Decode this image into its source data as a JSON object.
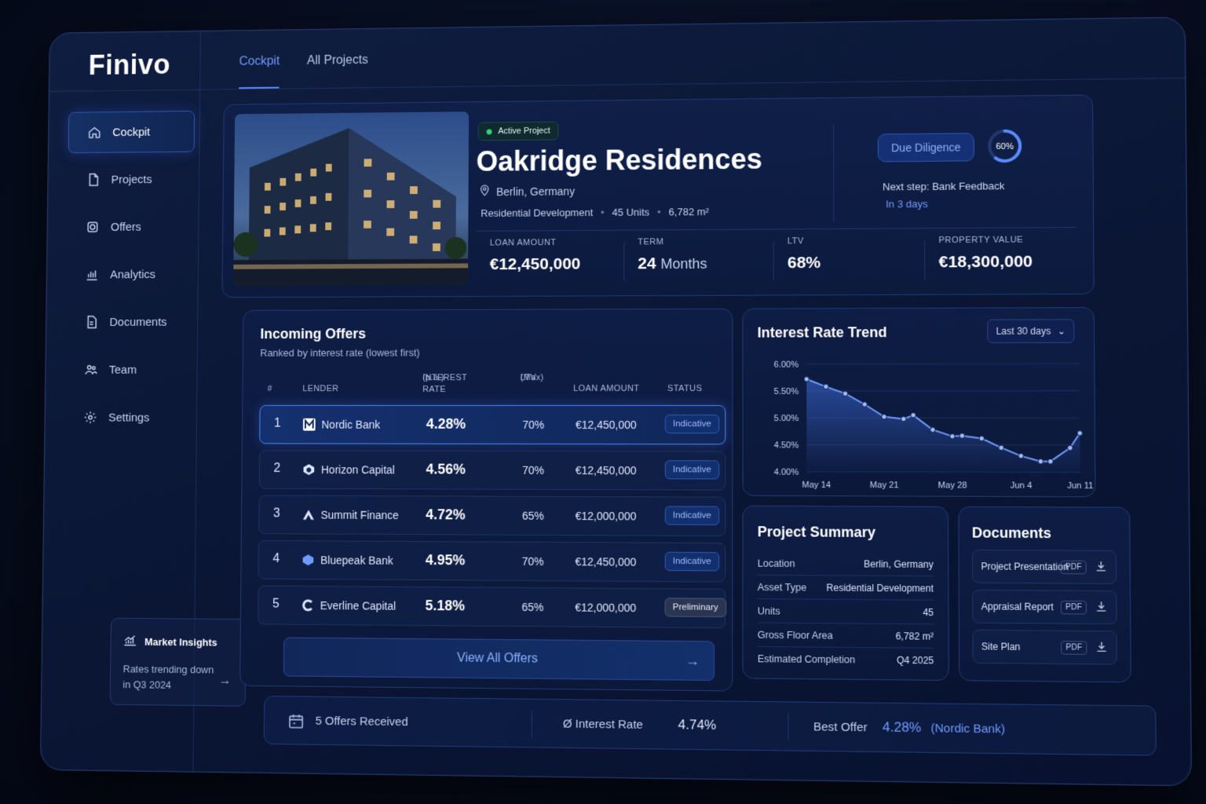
{
  "app": {
    "name": "Finivo"
  },
  "tabs": [
    {
      "label": "Cockpit",
      "active": true
    },
    {
      "label": "All Projects",
      "active": false
    }
  ],
  "sidebar": {
    "items": [
      {
        "label": "Cockpit",
        "icon": "home-icon",
        "active": true
      },
      {
        "label": "Projects",
        "icon": "file-icon"
      },
      {
        "label": "Offers",
        "icon": "offer-icon"
      },
      {
        "label": "Analytics",
        "icon": "bar-chart-icon"
      },
      {
        "label": "Documents",
        "icon": "document-icon"
      },
      {
        "label": "Team",
        "icon": "team-icon"
      },
      {
        "label": "Settings",
        "icon": "gear-icon"
      }
    ],
    "insights": {
      "title": "Market Insights",
      "text": "Rates trending down in Q3 2024"
    }
  },
  "project": {
    "badge": "Active Project",
    "title": "Oakridge Residences",
    "location": "Berlin, Germany",
    "type": "Residential Development",
    "units": "45 Units",
    "area": "6,782 m²",
    "stage": "Due Diligence",
    "progress_label": "60%",
    "progress": 0.6,
    "next_step": "Next step: Bank Feedback",
    "next_when": "In 3 days",
    "stats": [
      {
        "label": "LOAN AMOUNT",
        "value": "€12,450,000",
        "unit": ""
      },
      {
        "label": "TERM",
        "value": "24",
        "unit": "Months"
      },
      {
        "label": "LTV",
        "value": "68%",
        "unit": ""
      },
      {
        "label": "PROPERTY VALUE",
        "value": "€18,300,000",
        "unit": ""
      }
    ]
  },
  "offers": {
    "title": "Incoming Offers",
    "subtitle": "Ranked by interest rate (lowest first)",
    "headers": {
      "rank": "#",
      "lender": "LENDER",
      "rate": "INTEREST RATE",
      "rate_sub": "(p.a.)",
      "ltv": "LTV",
      "ltv_sub": "(Max)",
      "amount": "LOAN AMOUNT",
      "status": "STATUS"
    },
    "rows": [
      {
        "rank": "1",
        "lender": "Nordic Bank",
        "rate": "4.28%",
        "ltv": "70%",
        "amount": "€12,450,000",
        "status": "Indicative"
      },
      {
        "rank": "2",
        "lender": "Horizon Capital",
        "rate": "4.56%",
        "ltv": "70%",
        "amount": "€12,450,000",
        "status": "Indicative"
      },
      {
        "rank": "3",
        "lender": "Summit Finance",
        "rate": "4.72%",
        "ltv": "65%",
        "amount": "€12,000,000",
        "status": "Indicative"
      },
      {
        "rank": "4",
        "lender": "Bluepeak Bank",
        "rate": "4.95%",
        "ltv": "70%",
        "amount": "€12,450,000",
        "status": "Indicative"
      },
      {
        "rank": "5",
        "lender": "Everline Capital",
        "rate": "5.18%",
        "ltv": "65%",
        "amount": "€12,000,000",
        "status": "Preliminary"
      }
    ],
    "view_all": "View All Offers"
  },
  "trend": {
    "title": "Interest Rate Trend",
    "range": "Last 30 days"
  },
  "chart_data": {
    "type": "line",
    "title": "Interest Rate Trend",
    "y_ticks": [
      "6.00%",
      "5.50%",
      "5.00%",
      "4.50%",
      "4.00%"
    ],
    "x_ticks": [
      "May 14",
      "May 21",
      "May 28",
      "Jun 4",
      "Jun 11"
    ],
    "ylim": [
      4.0,
      6.0
    ],
    "x": [
      0,
      2,
      4,
      6,
      8,
      10,
      11,
      13,
      15,
      16,
      18,
      20,
      22,
      24,
      25,
      27,
      28
    ],
    "values": [
      5.72,
      5.58,
      5.45,
      5.25,
      5.02,
      4.98,
      5.05,
      4.78,
      4.66,
      4.67,
      4.62,
      4.45,
      4.3,
      4.2,
      4.2,
      4.45,
      4.72
    ],
    "x_tick_positions": [
      1,
      8,
      15,
      22,
      28
    ],
    "grid": true,
    "fill": true
  },
  "summary": {
    "title": "Project Summary",
    "rows": [
      {
        "label": "Location",
        "value": "Berlin, Germany"
      },
      {
        "label": "Asset Type",
        "value": "Residential Development"
      },
      {
        "label": "Units",
        "value": "45"
      },
      {
        "label": "Gross Floor Area",
        "value": "6,782 m²"
      },
      {
        "label": "Estimated Completion",
        "value": "Q4 2025"
      }
    ]
  },
  "documents": {
    "title": "Documents",
    "items": [
      {
        "name": "Project Presentation",
        "type": "PDF"
      },
      {
        "name": "Appraisal Report",
        "type": "PDF"
      },
      {
        "name": "Site Plan",
        "type": "PDF"
      }
    ]
  },
  "footer": {
    "offers_received": "5 Offers Received",
    "avg_label": "Ø Interest Rate",
    "avg_value": "4.74%",
    "best_label": "Best Offer",
    "best_value": "4.28%",
    "best_lender": "(Nordic Bank)"
  },
  "colors": {
    "accent": "#5a8bff",
    "background": "#0a1634",
    "success": "#33d17a"
  }
}
